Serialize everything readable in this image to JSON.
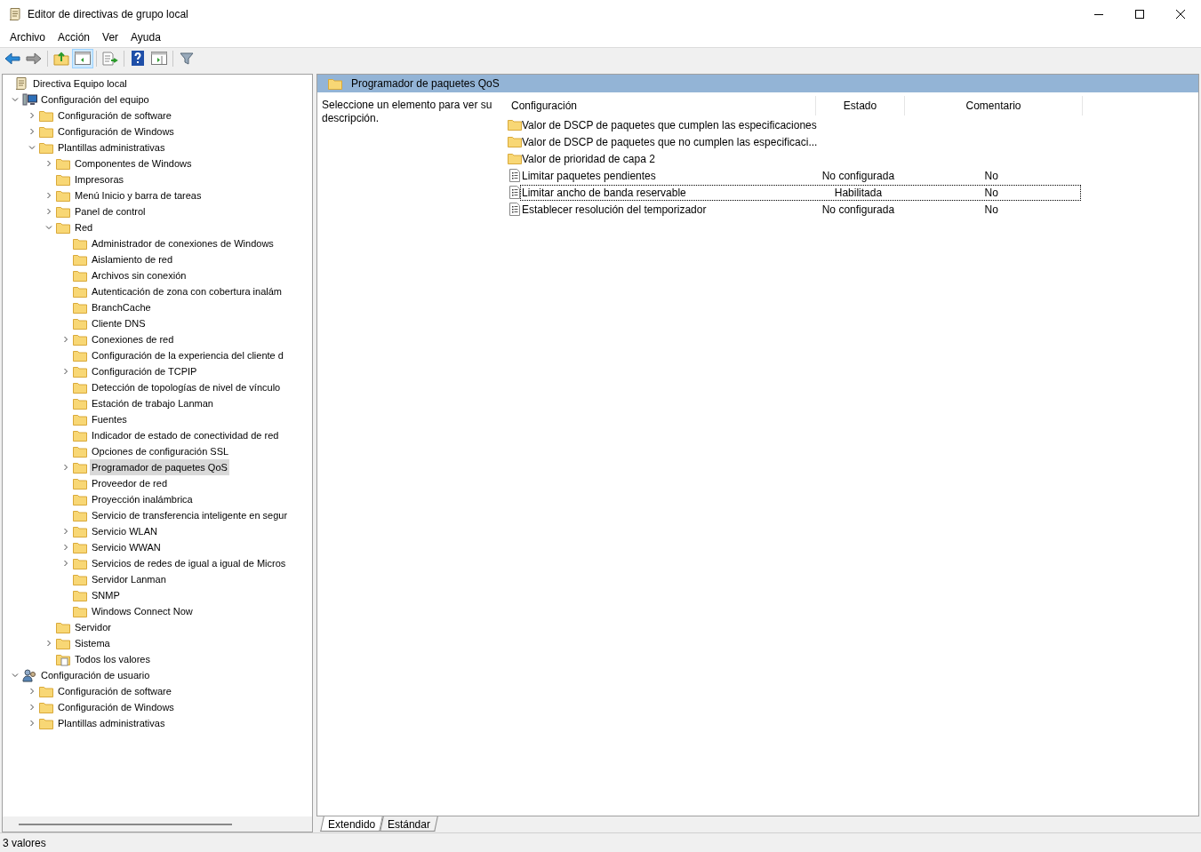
{
  "window": {
    "title": "Editor de directivas de grupo local"
  },
  "menu": [
    {
      "label": "Archivo"
    },
    {
      "label": "Acción"
    },
    {
      "label": "Ver"
    },
    {
      "label": "Ayuda"
    }
  ],
  "toolbar": [
    {
      "kind": "back"
    },
    {
      "kind": "forward"
    },
    {
      "kind": "sep"
    },
    {
      "kind": "up"
    },
    {
      "kind": "tree",
      "active": true
    },
    {
      "kind": "sep"
    },
    {
      "kind": "export"
    },
    {
      "kind": "sep"
    },
    {
      "kind": "help"
    },
    {
      "kind": "panel"
    },
    {
      "kind": "sep"
    },
    {
      "kind": "filter"
    }
  ],
  "tree": [
    {
      "label": "Directiva Equipo local",
      "kind": "policy",
      "selected": false,
      "children": [
        {
          "label": "Configuración del equipo",
          "kind": "computer",
          "expanded": true,
          "selected": false,
          "children": [
            {
              "label": "Configuración de software",
              "kind": "folder",
              "expanded": false,
              "selected": false
            },
            {
              "label": "Configuración de Windows",
              "kind": "folder",
              "expanded": false,
              "selected": false
            },
            {
              "label": "Plantillas administrativas",
              "kind": "folder",
              "expanded": true,
              "selected": false,
              "children": [
                {
                  "label": "Componentes de Windows",
                  "kind": "folder",
                  "expanded": false,
                  "selected": false
                },
                {
                  "label": "Impresoras",
                  "kind": "folder",
                  "selected": false
                },
                {
                  "label": "Menú Inicio y barra de tareas",
                  "kind": "folder",
                  "expanded": false,
                  "selected": false
                },
                {
                  "label": "Panel de control",
                  "kind": "folder",
                  "expanded": false,
                  "selected": false
                },
                {
                  "label": "Red",
                  "kind": "folder",
                  "expanded": true,
                  "selected": false,
                  "children": [
                    {
                      "label": "Administrador de conexiones de Windows",
                      "kind": "folder",
                      "selected": false
                    },
                    {
                      "label": "Aislamiento de red",
                      "kind": "folder",
                      "selected": false
                    },
                    {
                      "label": "Archivos sin conexión",
                      "kind": "folder",
                      "selected": false
                    },
                    {
                      "label": "Autenticación de zona con cobertura inalám",
                      "kind": "folder",
                      "selected": false
                    },
                    {
                      "label": "BranchCache",
                      "kind": "folder",
                      "selected": false
                    },
                    {
                      "label": "Cliente DNS",
                      "kind": "folder",
                      "selected": false
                    },
                    {
                      "label": "Conexiones de red",
                      "kind": "folder",
                      "expanded": false,
                      "selected": false
                    },
                    {
                      "label": "Configuración de la experiencia del cliente d",
                      "kind": "folder",
                      "selected": false
                    },
                    {
                      "label": "Configuración de TCPIP",
                      "kind": "folder",
                      "expanded": false,
                      "selected": false
                    },
                    {
                      "label": "Detección de topologías de nivel de vínculo",
                      "kind": "folder",
                      "selected": false
                    },
                    {
                      "label": "Estación de trabajo Lanman",
                      "kind": "folder",
                      "selected": false
                    },
                    {
                      "label": "Fuentes",
                      "kind": "folder",
                      "selected": false
                    },
                    {
                      "label": "Indicador de estado de conectividad de red",
                      "kind": "folder",
                      "selected": false
                    },
                    {
                      "label": "Opciones de configuración SSL",
                      "kind": "folder",
                      "selected": false
                    },
                    {
                      "label": "Programador de paquetes QoS",
                      "kind": "folder",
                      "expanded": false,
                      "selected": true
                    },
                    {
                      "label": "Proveedor de red",
                      "kind": "folder",
                      "selected": false
                    },
                    {
                      "label": "Proyección inalámbrica",
                      "kind": "folder",
                      "selected": false
                    },
                    {
                      "label": "Servicio de transferencia inteligente en segur",
                      "kind": "folder",
                      "selected": false
                    },
                    {
                      "label": "Servicio WLAN",
                      "kind": "folder",
                      "expanded": false,
                      "selected": false
                    },
                    {
                      "label": "Servicio WWAN",
                      "kind": "folder",
                      "expanded": false,
                      "selected": false
                    },
                    {
                      "label": "Servicios de redes de igual a igual de Micros",
                      "kind": "folder",
                      "expanded": false,
                      "selected": false
                    },
                    {
                      "label": "Servidor Lanman",
                      "kind": "folder",
                      "selected": false
                    },
                    {
                      "label": "SNMP",
                      "kind": "folder",
                      "selected": false
                    },
                    {
                      "label": "Windows Connect Now",
                      "kind": "folder",
                      "selected": false
                    }
                  ]
                },
                {
                  "label": "Servidor",
                  "kind": "folder",
                  "selected": false
                },
                {
                  "label": "Sistema",
                  "kind": "folder",
                  "expanded": false,
                  "selected": false
                },
                {
                  "label": "Todos los valores",
                  "kind": "allvalues",
                  "selected": false
                }
              ]
            }
          ]
        },
        {
          "label": "Configuración de usuario",
          "kind": "user",
          "expanded": true,
          "selected": false,
          "children": [
            {
              "label": "Configuración de software",
              "kind": "folder",
              "expanded": false,
              "selected": false
            },
            {
              "label": "Configuración de Windows",
              "kind": "folder",
              "expanded": false,
              "selected": false
            },
            {
              "label": "Plantillas administrativas",
              "kind": "folder",
              "expanded": false,
              "selected": false
            }
          ]
        }
      ]
    }
  ],
  "details": {
    "header": "Programador de paquetes QoS",
    "description": "Seleccione un elemento para ver su descripción.",
    "columns": [
      "Configuración",
      "Estado",
      "Comentario"
    ],
    "rows": [
      {
        "kind": "folder",
        "name": "Valor de DSCP de paquetes que cumplen las especificaciones",
        "focused": false
      },
      {
        "kind": "folder",
        "name": "Valor de DSCP de paquetes que no cumplen las especificaci...",
        "focused": false
      },
      {
        "kind": "folder",
        "name": "Valor de prioridad de capa 2",
        "focused": false
      },
      {
        "kind": "setting",
        "name": "Limitar paquetes pendientes",
        "state": "No configurada",
        "comment": "No",
        "focused": false
      },
      {
        "kind": "setting",
        "name": "Limitar ancho de banda reservable",
        "state": "Habilitada",
        "comment": "No",
        "focused": true
      },
      {
        "kind": "setting",
        "name": "Establecer resolución del temporizador",
        "state": "No configurada",
        "comment": "No",
        "focused": false
      }
    ],
    "tabs": [
      {
        "label": "Extendido",
        "selected": true
      },
      {
        "label": "Estándar",
        "selected": false
      }
    ]
  },
  "status_bar": "3 valores"
}
